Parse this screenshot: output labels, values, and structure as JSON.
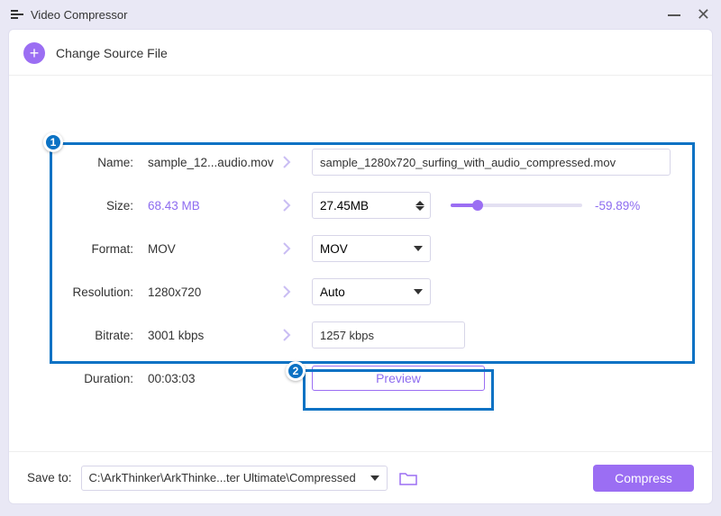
{
  "window": {
    "title": "Video Compressor"
  },
  "top": {
    "change_source": "Change Source File"
  },
  "labels": {
    "name": "Name:",
    "size": "Size:",
    "format": "Format:",
    "resolution": "Resolution:",
    "bitrate": "Bitrate:",
    "duration": "Duration:"
  },
  "source": {
    "name": "sample_12...audio.mov",
    "size": "68.43 MB",
    "format": "MOV",
    "resolution": "1280x720",
    "bitrate": "3001 kbps",
    "duration": "00:03:03"
  },
  "output": {
    "name": "sample_1280x720_surfing_with_audio_compressed.mov",
    "size": "27.45MB",
    "format": "MOV",
    "resolution": "Auto",
    "bitrate": "1257 kbps",
    "percent": "-59.89%"
  },
  "actions": {
    "preview": "Preview",
    "compress": "Compress"
  },
  "bottom": {
    "save_to_label": "Save to:",
    "path": "C:\\ArkThinker\\ArkThinke...ter Ultimate\\Compressed"
  },
  "annotations": {
    "one": "1",
    "two": "2"
  },
  "colors": {
    "accent": "#9b6ef3",
    "highlight": "#0b72c4"
  }
}
